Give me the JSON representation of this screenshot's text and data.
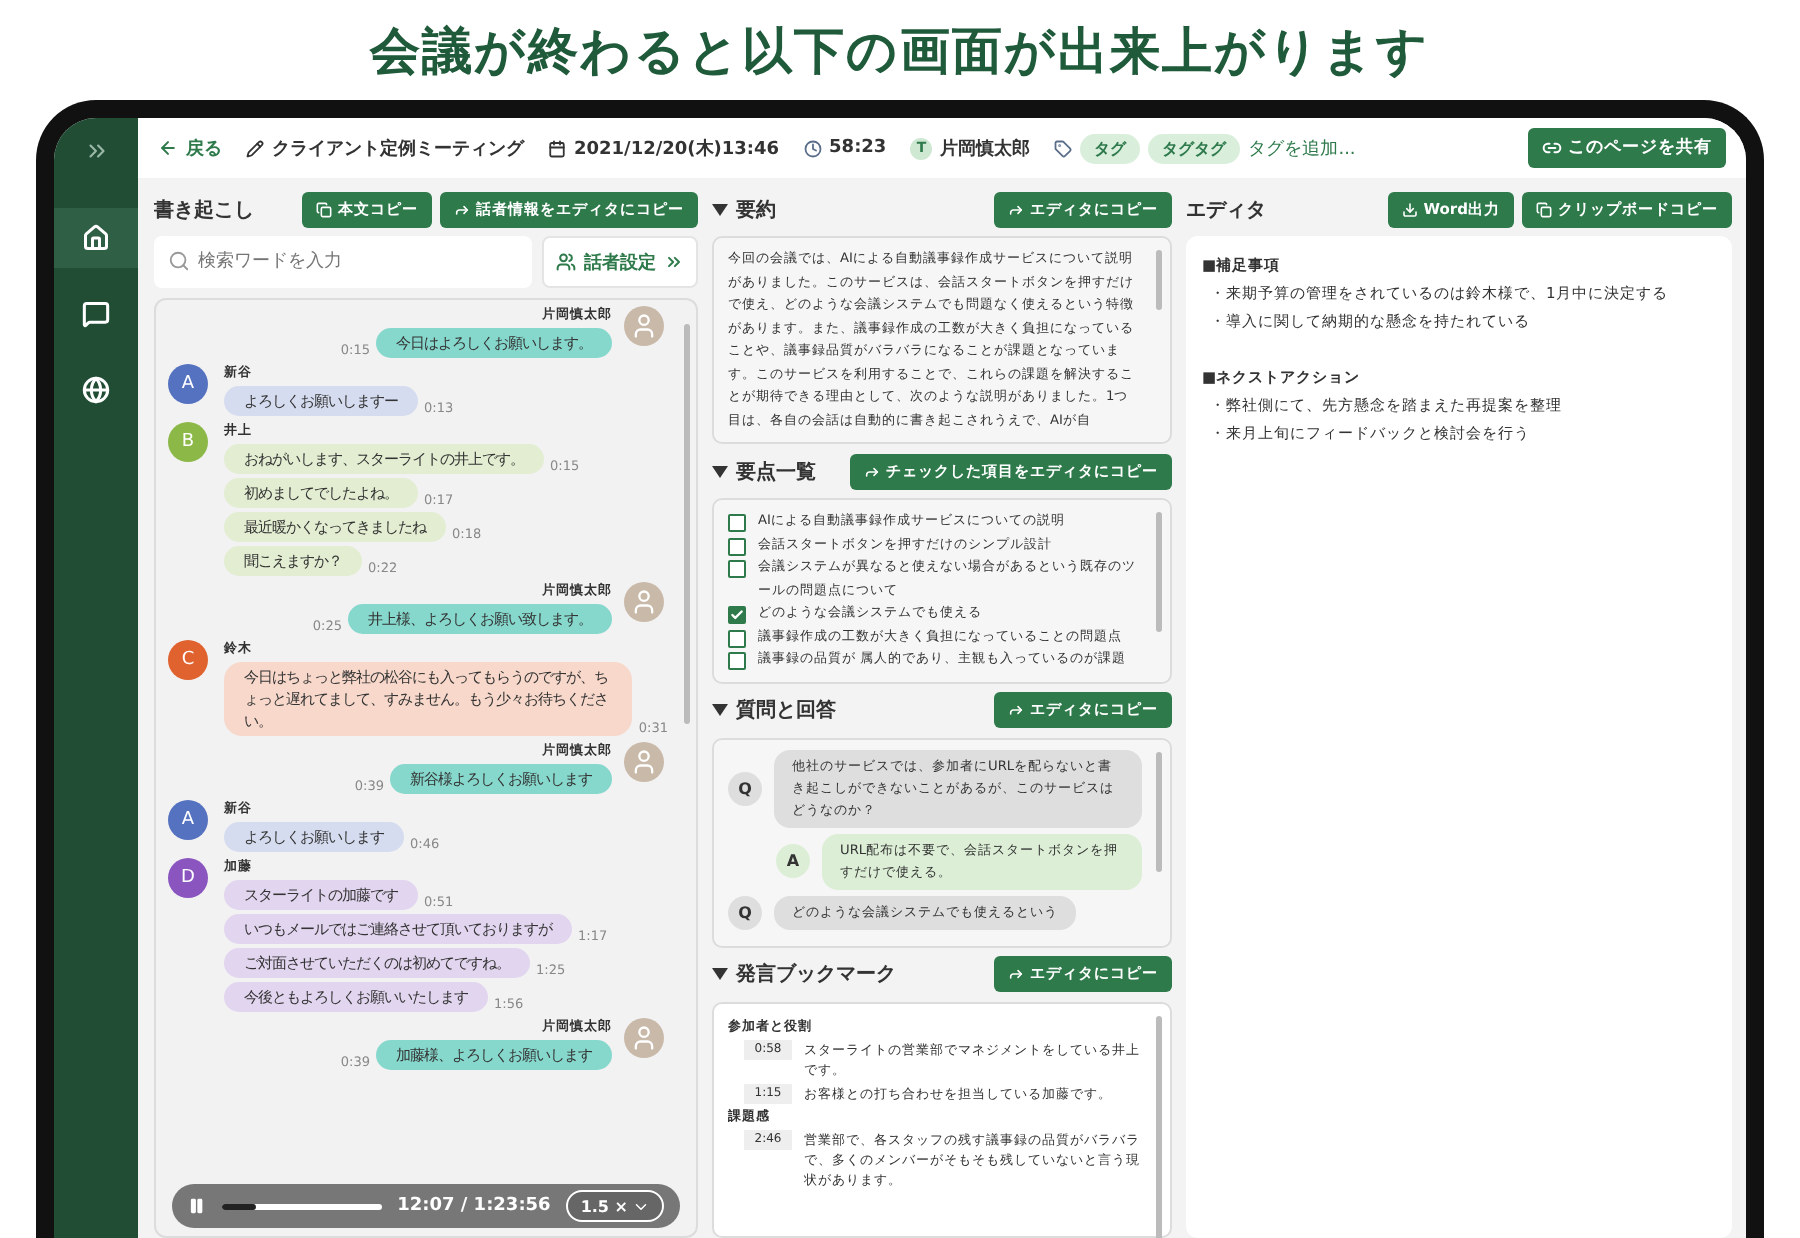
{
  "headline": "会議が終わると以下の画面が出来上がります",
  "sidebar": {
    "items": [
      {
        "kind": "home",
        "selected": true
      },
      {
        "kind": "chat",
        "selected": false
      },
      {
        "kind": "globe",
        "selected": false
      }
    ]
  },
  "topbar": {
    "back": "戻る",
    "title": "クライアント定例ミーティング",
    "date": "2021/12/20(木)13:46",
    "duration": "58:23",
    "owner_initial": "T",
    "owner": "片岡慎太郎",
    "tags": [
      "タグ",
      "タグタグ"
    ],
    "add_tag_placeholder": "タグを追加...",
    "share": "このページを共有"
  },
  "transcript": {
    "title": "書き起こし",
    "buttons": [
      "本文コピー",
      "話者情報をエディタにコピー"
    ],
    "search_placeholder": "検索ワードを入力",
    "speaker_settings": "話者設定",
    "groups": [
      {
        "kind": "self",
        "name": "片岡慎太郎",
        "messages": [
          {
            "text": "今日はよろしくお願いします。",
            "time": "0:15"
          }
        ]
      },
      {
        "kind": "other",
        "initial": "A",
        "color": "#5572c0",
        "name": "新谷",
        "messages": [
          {
            "text": "よろしくお願いしますー",
            "time": "0:13"
          }
        ]
      },
      {
        "kind": "other",
        "initial": "B",
        "color": "#8cb847",
        "name": "井上",
        "messages": [
          {
            "text": "おねがいします、スターライトの井上です。",
            "time": "0:15"
          },
          {
            "text": "初めましてでしたよね。",
            "time": "0:17"
          },
          {
            "text": "最近暖かくなってきましたね",
            "time": "0:18"
          },
          {
            "text": "聞こえますか？",
            "time": "0:22"
          }
        ]
      },
      {
        "kind": "self",
        "name": "片岡慎太郎",
        "messages": [
          {
            "text": "井上様、よろしくお願い致します。",
            "time": "0:25"
          }
        ]
      },
      {
        "kind": "other",
        "initial": "C",
        "color": "#e0622f",
        "name": "鈴木",
        "messages": [
          {
            "text": "今日はちょっと弊社の松谷にも入ってもらうのですが、ちょっと遅れてまして、すみません。もう少々お待ちください。",
            "time": "0:31"
          }
        ]
      },
      {
        "kind": "self",
        "name": "片岡慎太郎",
        "messages": [
          {
            "text": "新谷様よろしくお願いします",
            "time": "0:39"
          }
        ]
      },
      {
        "kind": "other",
        "initial": "A",
        "color": "#5572c0",
        "name": "新谷",
        "messages": [
          {
            "text": "よろしくお願いします",
            "time": "0:46"
          }
        ]
      },
      {
        "kind": "other",
        "initial": "D",
        "color": "#8a55bf",
        "name": "加藤",
        "messages": [
          {
            "text": "スターライトの加藤です",
            "time": "0:51"
          },
          {
            "text": "いつもメールではご連絡させて頂いておりますが",
            "time": "1:17"
          },
          {
            "text": "ご対面させていただくのは初めてですね。",
            "time": "1:25"
          },
          {
            "text": "今後ともよろしくお願いいたします",
            "time": "1:56"
          }
        ]
      },
      {
        "kind": "self",
        "name": "片岡慎太郎",
        "messages": [
          {
            "text": "加藤様、よろしくお願いします",
            "time": "0:39"
          }
        ]
      }
    ],
    "player": {
      "time": "12:07 / 1:23:56",
      "speed": "1.5 ×",
      "level": 0.22
    }
  },
  "summary": {
    "title": "要約",
    "button": "エディタにコピー",
    "text": "今回の会議では、AIによる自動議事録作成サービスについて説明がありました。このサービスは、会話スタートボタンを押すだけで使え、どのような会議システムでも問題なく使えるという特徴があります。また、議事録作成の工数が大きく負担になっていることや、議事録品質がバラバラになることが課題となっています。このサービスを利用することで、これらの課題を解決することが期待できる理由として、次のような説明がありました。1つ目は、各自の会話は自動的に書き起こされうえで、AIが自"
  },
  "key_points": {
    "title": "要点一覧",
    "button": "チェックした項目をエディタにコピー",
    "items": [
      {
        "text": "AIによる自動議事録作成サービスについての説明",
        "checked": false
      },
      {
        "text": "会話スタートボタンを押すだけのシンプル設計",
        "checked": false
      },
      {
        "text": "会議システムが異なると使えない場合があるという既存のツールの問題点について",
        "checked": false
      },
      {
        "text": "どのような会議システムでも使える",
        "checked": true
      },
      {
        "text": "議事録作成の工数が大きく負担になっていることの問題点",
        "checked": false
      },
      {
        "text": "議事録の品質が 属人的であり、主観も入っているのが課題",
        "checked": false
      }
    ]
  },
  "qa": {
    "title": "質問と回答",
    "button": "エディタにコピー",
    "items": [
      {
        "kind": "q",
        "label": "Q",
        "text": "他社のサービスでは、参加者にURLを配らないと書き起こしができないことがあるが、このサービスはどうなのか？"
      },
      {
        "kind": "a",
        "label": "A",
        "text": "URL配布は不要で、会話スタートボタンを押すだけで使える。"
      },
      {
        "kind": "q",
        "label": "Q",
        "text": "どのような会議システムでも使えるという"
      }
    ]
  },
  "bookmarks": {
    "title": "発言ブックマーク",
    "button": "エディタにコピー",
    "sections": [
      {
        "heading": "参加者と役割",
        "items": [
          {
            "time": "0:58",
            "text": "スターライトの営業部でマネジメントをしている井上です。"
          },
          {
            "time": "1:15",
            "text": "お客様との打ち合わせを担当している加藤です。"
          }
        ]
      },
      {
        "heading": "課題感",
        "items": [
          {
            "time": "2:46",
            "text": "営業部で、各スタッフの残す議事録の品質がバラバラで、多くのメンバーがそもそも残していないと言う現状があります。"
          }
        ]
      }
    ]
  },
  "editor": {
    "title": "エディタ",
    "buttons": [
      {
        "kind": "download",
        "label": "Word出力"
      },
      {
        "kind": "copy",
        "label": "クリップボードコピー"
      }
    ],
    "sections": [
      {
        "heading": "■補足事項",
        "bullets": [
          "・来期予算の管理をされているのは鈴木様で、1月中に決定する",
          "・導入に関して納期的な懸念を持たれている"
        ]
      },
      {
        "heading": "■ネクストアクション",
        "bullets": [
          "・弊社側にて、先方懸念を踏まえた再提案を整理",
          "・来月上旬にフィードバックと検討会を行う"
        ]
      }
    ]
  }
}
